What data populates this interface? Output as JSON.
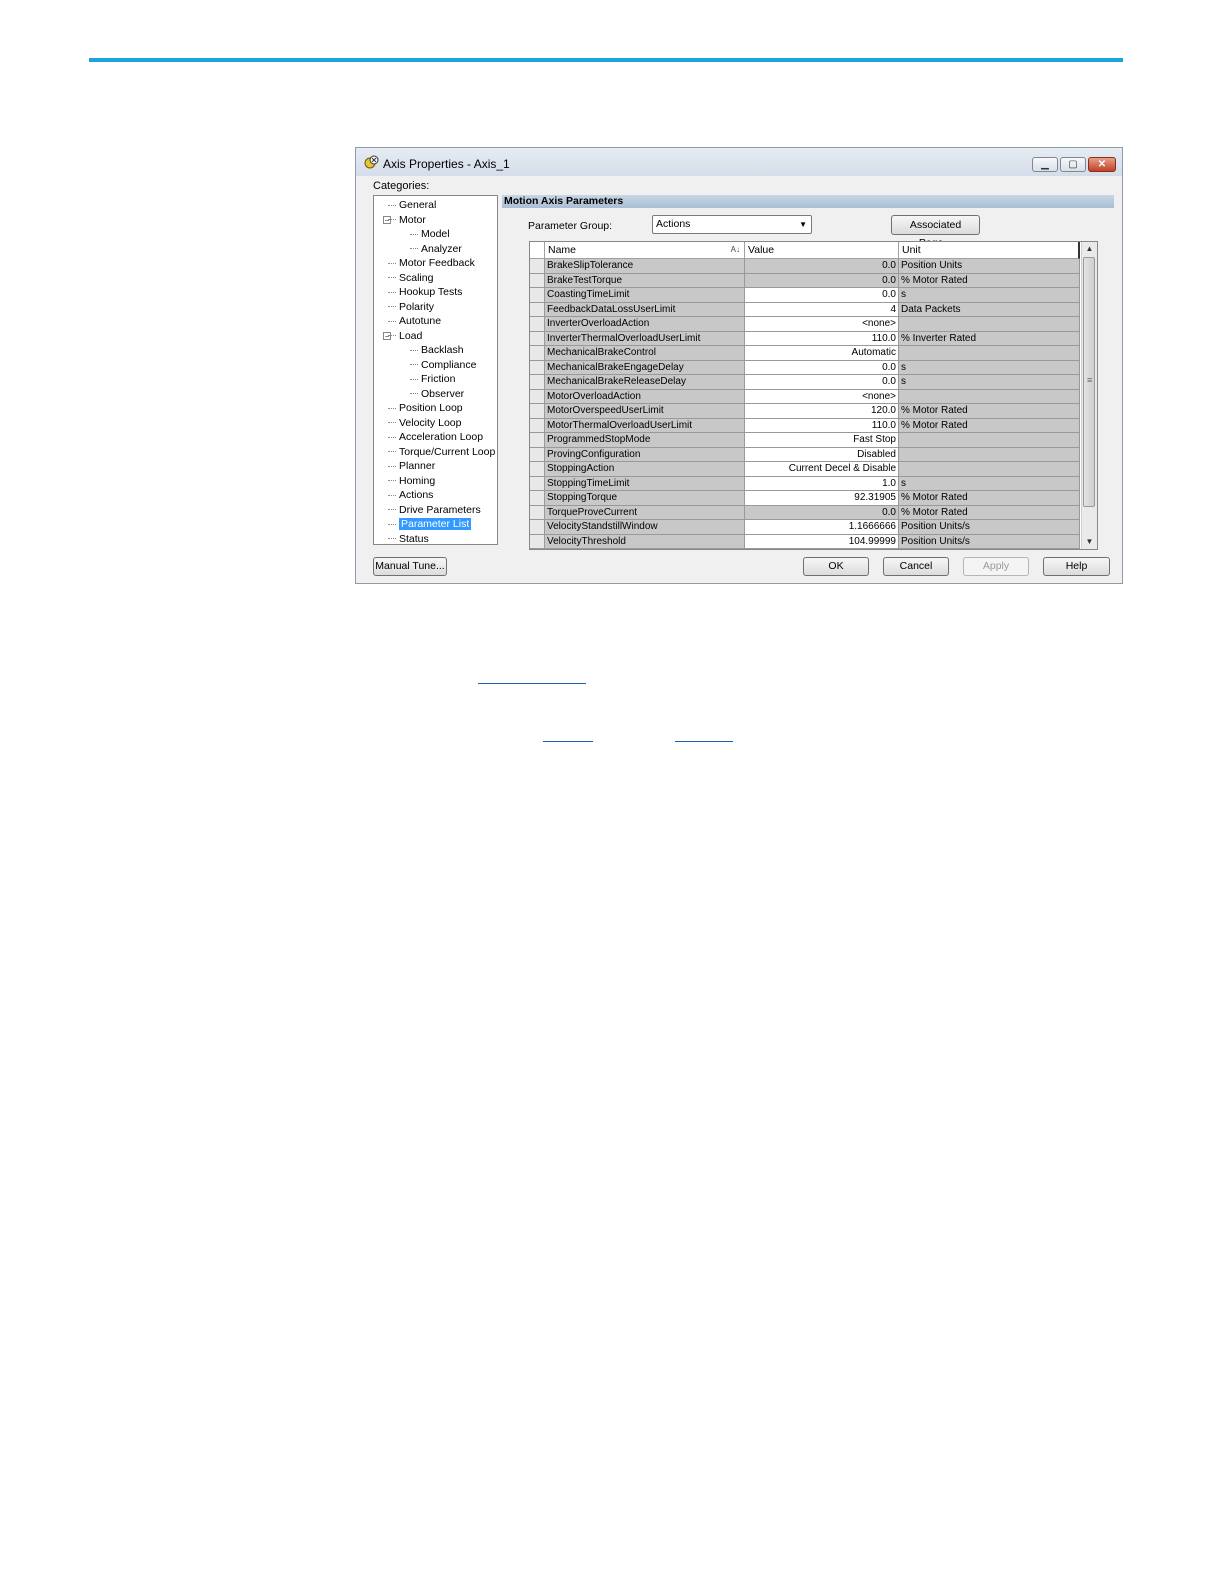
{
  "colors": {
    "accent_line": "#1aa3dd",
    "selection": "#3399ff",
    "link": "#1e5fb8"
  },
  "window": {
    "title": "Axis Properties - Axis_1",
    "controls": {
      "minimize_icon": "minimize-icon",
      "maximize_icon": "maximize-icon",
      "close_icon": "close-icon"
    }
  },
  "categories": {
    "label": "Categories:",
    "items": [
      {
        "label": "General",
        "level": 0
      },
      {
        "label": "Motor",
        "level": 0,
        "expander": true
      },
      {
        "label": "Model",
        "level": 1
      },
      {
        "label": "Analyzer",
        "level": 1
      },
      {
        "label": "Motor Feedback",
        "level": 0
      },
      {
        "label": "Scaling",
        "level": 0
      },
      {
        "label": "Hookup Tests",
        "level": 0
      },
      {
        "label": "Polarity",
        "level": 0
      },
      {
        "label": "Autotune",
        "level": 0
      },
      {
        "label": "Load",
        "level": 0,
        "expander": true
      },
      {
        "label": "Backlash",
        "level": 1
      },
      {
        "label": "Compliance",
        "level": 1
      },
      {
        "label": "Friction",
        "level": 1
      },
      {
        "label": "Observer",
        "level": 1
      },
      {
        "label": "Position Loop",
        "level": 0
      },
      {
        "label": "Velocity Loop",
        "level": 0
      },
      {
        "label": "Acceleration Loop",
        "level": 0
      },
      {
        "label": "Torque/Current Loop",
        "level": 0
      },
      {
        "label": "Planner",
        "level": 0
      },
      {
        "label": "Homing",
        "level": 0
      },
      {
        "label": "Actions",
        "level": 0
      },
      {
        "label": "Drive Parameters",
        "level": 0
      },
      {
        "label": "Parameter List",
        "level": 0,
        "selected": true
      },
      {
        "label": "Status",
        "level": 0
      }
    ]
  },
  "main": {
    "section_title": "Motion Axis Parameters",
    "parameter_group_label": "Parameter Group:",
    "parameter_group_value": "Actions",
    "associated_page_button": "Associated Page...",
    "columns": {
      "name": "Name",
      "value": "Value",
      "unit": "Unit"
    },
    "rows": [
      {
        "name": "BrakeSlipTolerance",
        "value": "0.0",
        "unit": "Position Units",
        "editable": false
      },
      {
        "name": "BrakeTestTorque",
        "value": "0.0",
        "unit": "% Motor Rated",
        "editable": false
      },
      {
        "name": "CoastingTimeLimit",
        "value": "0.0",
        "unit": "s",
        "editable": true
      },
      {
        "name": "FeedbackDataLossUserLimit",
        "value": "4",
        "unit": "Data Packets",
        "editable": true
      },
      {
        "name": "InverterOverloadAction",
        "value": "<none>",
        "unit": "",
        "editable": true
      },
      {
        "name": "InverterThermalOverloadUserLimit",
        "value": "110.0",
        "unit": "% Inverter Rated",
        "editable": true
      },
      {
        "name": "MechanicalBrakeControl",
        "value": "Automatic",
        "unit": "",
        "editable": true
      },
      {
        "name": "MechanicalBrakeEngageDelay",
        "value": "0.0",
        "unit": "s",
        "editable": true
      },
      {
        "name": "MechanicalBrakeReleaseDelay",
        "value": "0.0",
        "unit": "s",
        "editable": true
      },
      {
        "name": "MotorOverloadAction",
        "value": "<none>",
        "unit": "",
        "editable": true
      },
      {
        "name": "MotorOverspeedUserLimit",
        "value": "120.0",
        "unit": "% Motor Rated",
        "editable": true
      },
      {
        "name": "MotorThermalOverloadUserLimit",
        "value": "110.0",
        "unit": "% Motor Rated",
        "editable": true
      },
      {
        "name": "ProgrammedStopMode",
        "value": "Fast Stop",
        "unit": "",
        "editable": true
      },
      {
        "name": "ProvingConfiguration",
        "value": "Disabled",
        "unit": "",
        "editable": true
      },
      {
        "name": "StoppingAction",
        "value": "Current Decel & Disable",
        "unit": "",
        "editable": true
      },
      {
        "name": "StoppingTimeLimit",
        "value": "1.0",
        "unit": "s",
        "editable": true
      },
      {
        "name": "StoppingTorque",
        "value": "92.31905",
        "unit": "% Motor Rated",
        "editable": true
      },
      {
        "name": "TorqueProveCurrent",
        "value": "0.0",
        "unit": "% Motor Rated",
        "editable": false
      },
      {
        "name": "VelocityStandstillWindow",
        "value": "1.1666666",
        "unit": "Position Units/s",
        "editable": true
      },
      {
        "name": "VelocityThreshold",
        "value": "104.99999",
        "unit": "Position Units/s",
        "editable": true
      }
    ]
  },
  "footer": {
    "manual_tune": "Manual Tune...",
    "ok": "OK",
    "cancel": "Cancel",
    "apply": "Apply",
    "help": "Help"
  }
}
